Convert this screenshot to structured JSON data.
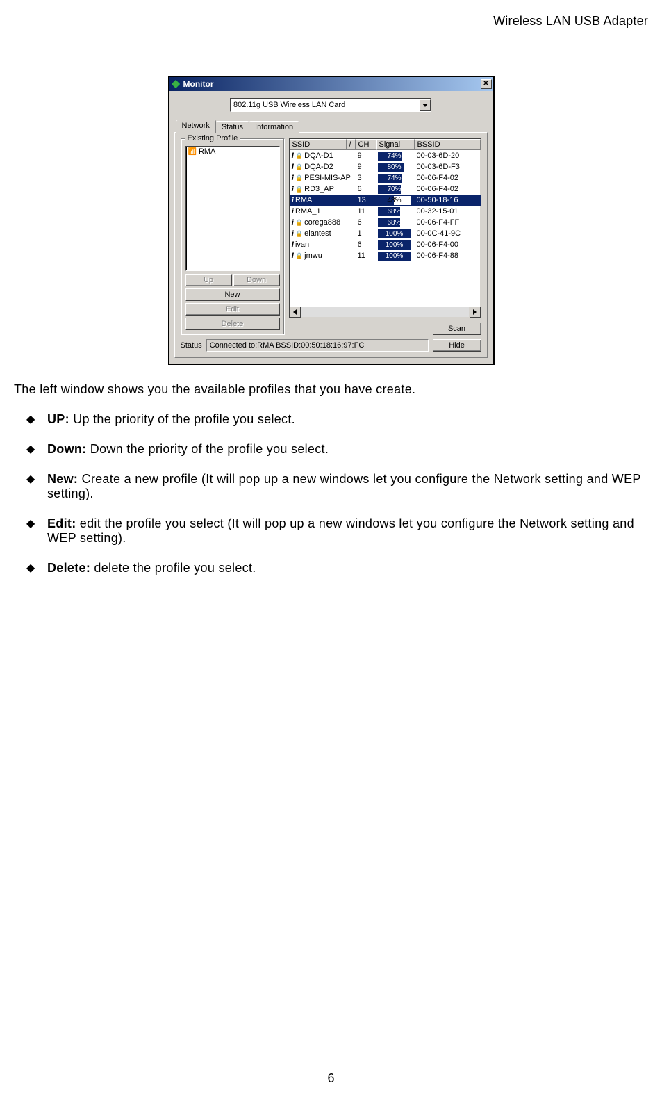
{
  "header": {
    "title": "Wireless LAN USB Adapter"
  },
  "window": {
    "title": "Monitor",
    "combo": "802.11g USB Wireless LAN Card",
    "tabs": [
      "Network",
      "Status",
      "Information"
    ],
    "groupLegend": "Existing Profile",
    "profileItem": "RMA",
    "buttons": {
      "up": "Up",
      "down": "Down",
      "new": "New",
      "edit": "Edit",
      "delete": "Delete",
      "scan": "Scan",
      "hide": "Hide"
    },
    "columns": {
      "ssid": "SSID",
      "sort": "/",
      "ch": "CH",
      "signal": "Signal",
      "bssid": "BSSID"
    },
    "rows": [
      {
        "lock": true,
        "ssid": "DQA-D1",
        "ch": "9",
        "sig": 74,
        "bssid": "00-03-6D-20"
      },
      {
        "lock": true,
        "ssid": "DQA-D2",
        "ch": "9",
        "sig": 80,
        "bssid": "00-03-6D-F3"
      },
      {
        "lock": true,
        "ssid": "PESI-MIS-AP",
        "ch": "3",
        "sig": 74,
        "bssid": "00-06-F4-02"
      },
      {
        "lock": true,
        "ssid": "RD3_AP",
        "ch": "6",
        "sig": 70,
        "bssid": "00-06-F4-02"
      },
      {
        "lock": false,
        "ssid": "RMA",
        "ch": "13",
        "sig": 48,
        "bssid": "00-50-18-16",
        "sel": true
      },
      {
        "lock": false,
        "ssid": "RMA_1",
        "ch": "11",
        "sig": 68,
        "bssid": "00-32-15-01"
      },
      {
        "lock": true,
        "ssid": "corega888",
        "ch": "6",
        "sig": 68,
        "bssid": "00-06-F4-FF"
      },
      {
        "lock": true,
        "ssid": "elantest",
        "ch": "1",
        "sig": 100,
        "bssid": "00-0C-41-9C"
      },
      {
        "lock": false,
        "ssid": "ivan",
        "ch": "6",
        "sig": 100,
        "bssid": "00-06-F4-00"
      },
      {
        "lock": true,
        "ssid": "jmwu",
        "ch": "11",
        "sig": 100,
        "bssid": "00-06-F4-88"
      }
    ],
    "statusLabel": "Status",
    "statusText": "Connected to:RMA    BSSID:00:50:18:16:97:FC"
  },
  "intro": "The left window shows you the available profiles that you have create.",
  "items": [
    {
      "term": "UP:",
      "desc": " Up the priority of the profile you select."
    },
    {
      "term": "Down:",
      "desc": " Down the priority of the profile you select."
    },
    {
      "term": "New:",
      "desc": " Create a new profile (It will pop up a new windows let you configure the Network setting and WEP setting)."
    },
    {
      "term": "Edit:",
      "desc": " edit the profile you select (It will pop up a new windows let you configure the Network setting and WEP setting)."
    },
    {
      "term": "Delete:",
      "desc": " delete the profile you select."
    }
  ],
  "pageNumber": "6"
}
